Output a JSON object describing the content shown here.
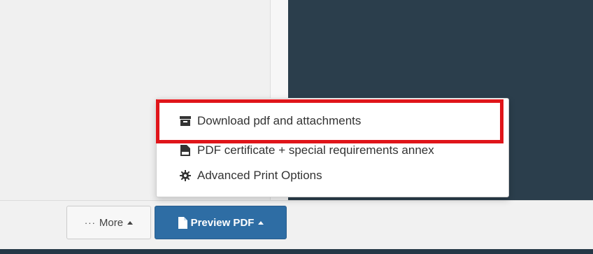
{
  "menu": {
    "items": [
      {
        "label": "Download pdf and attachments",
        "icon": "archive-icon"
      },
      {
        "label": "PDF certificate + special requirements annex",
        "icon": "pdf-file-icon"
      },
      {
        "label": "Advanced Print Options",
        "icon": "gear-icon"
      }
    ]
  },
  "toolbar": {
    "more_label": "More",
    "more_dots": "···",
    "preview_label": "Preview PDF"
  },
  "colors": {
    "highlight": "#e0151a",
    "primary_button": "#2e6da4",
    "dark_panel": "#2b3e4c"
  }
}
